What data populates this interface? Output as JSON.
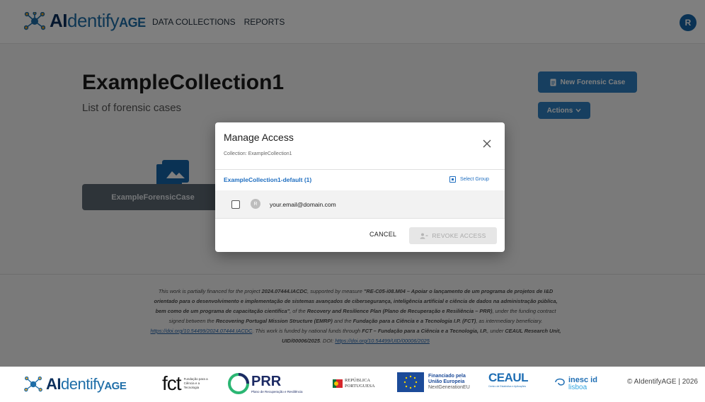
{
  "app": {
    "logo_main": "AI",
    "logo_thin": "dentify",
    "logo_age": "AGE"
  },
  "nav": {
    "items": [
      "DATA COLLECTIONS",
      "REPORTS"
    ]
  },
  "user": {
    "avatar_letter": "R",
    "avatar_color": "#1565a8"
  },
  "collection": {
    "title": "ExampleCollection1",
    "subtitle": "List of forensic cases",
    "new_case_label": "New Forensic Case",
    "actions_label": "Actions",
    "cases": [
      "ExampleForensicCase"
    ]
  },
  "modal": {
    "title": "Manage Access",
    "subtitle": "Collection: ExampleCollection1",
    "group_name": "ExampleCollection1-default (1)",
    "select_group_label": "Select Group",
    "members": [
      {
        "avatar": "R",
        "email": "your.email@domain.com",
        "checked": false
      }
    ],
    "cancel_label": "CANCEL",
    "revoke_label": "REVOKE ACCESS"
  },
  "footer": {
    "text_1": "This work is partially financed for the project ",
    "text_2": "2024.07444.IACDC",
    "text_3": ", supported by measure ",
    "text_4": "\"RE-C05-i08.M04 – Apoiar o lançamento de um programa de projetos de I&D orientado para o desenvolvimento e implementação de sistemas avançados de cibersegurança, inteligência artificial e ciência de dados na administração pública, bem como de um programa de capacitação científica\"",
    "text_5": ", of the ",
    "text_6": "Recovery and Resilience Plan (Plano de Recuperação e Resiliência – PRR)",
    "text_7": ", under the funding contract signed between the ",
    "text_8": "Recovering Portugal Mission Structure (EMRP)",
    "text_9": " and the ",
    "text_10": "Fundação para a Ciência e a Tecnologia I.P. (FCT)",
    "text_11": ", as intermediary beneficiary. ",
    "link_1": "https://doi.org/10.54499/2024.07444.IACDC",
    "text_12": ". This work is funded by national funds through ",
    "text_13": "FCT – Fundação para a Ciência e a Tecnologia, I.P.",
    "text_14": ", under ",
    "text_15": "CEAUL Research Unit, UID/00006/2025",
    "text_16": ". DOI: ",
    "link_2": "https://doi.org/10.54499/UID/00006/2025"
  },
  "sponsors": {
    "fct": "fct",
    "fct_small": "Fundação para a Ciência e a Tecnologia",
    "prr": "PRR",
    "prr_small": "Plano de Recuperação e Resiliência",
    "republica": "REPÚBLICA PORTUGUESA",
    "eu_line1": "Financiado pela",
    "eu_line2": "União Europeia",
    "eu_line3": "NextGenerationEU",
    "ceaul": "CEAUL",
    "ceaul_small": "Centro de Estatística e Aplicações",
    "inesc": "inesc id",
    "inesc_sub": "lisboa",
    "copyright": "© AIdentifyAGE | 2026"
  },
  "colors": {
    "primary": "#2f7fc0",
    "brand_dark": "#0b2f5c",
    "link": "#1f6ec0"
  }
}
